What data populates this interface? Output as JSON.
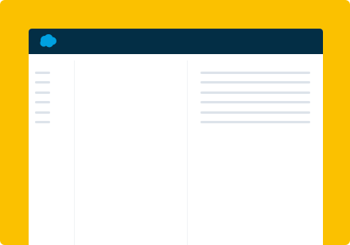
{
  "colors": {
    "backdrop": "#FBC100",
    "header": "#032E45",
    "logo": "#00A1E0",
    "skeleton": "#DDE3EA",
    "divider": "#F1F3F5"
  },
  "header": {
    "logo_icon": "salesforce-cloud-icon"
  },
  "sidebar": {
    "placeholder_item_count": 6
  },
  "detail": {
    "placeholder_line_count": 6
  }
}
